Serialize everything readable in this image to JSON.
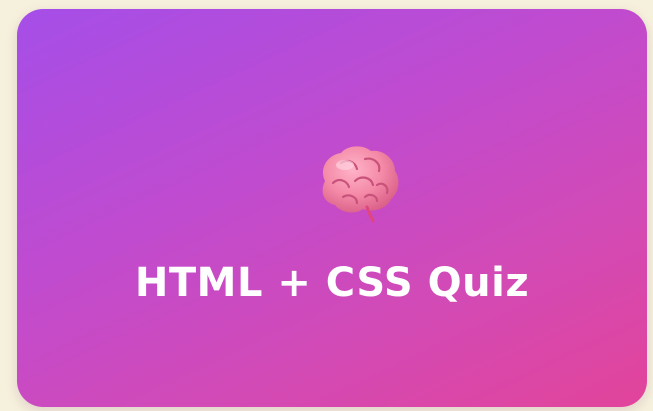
{
  "card": {
    "title": "HTML + CSS Quiz",
    "icon": "brain-icon"
  },
  "colors": {
    "background": "#f6f1dc",
    "gradient_start": "#a54ee8",
    "gradient_end": "#e2449a",
    "title_text": "#ffffff"
  }
}
